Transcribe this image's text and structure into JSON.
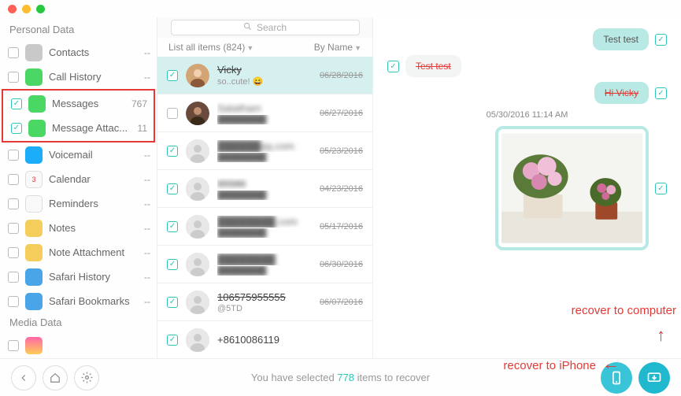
{
  "search_placeholder": "Search",
  "sidebar": {
    "section1": "Personal Data",
    "section2": "Media Data",
    "items": [
      {
        "label": "Contacts",
        "count": "--",
        "checked": false,
        "icon": "contacts",
        "color": "#c9c9c9"
      },
      {
        "label": "Call History",
        "count": "--",
        "checked": false,
        "icon": "phone",
        "color": "#4bd763"
      },
      {
        "label": "Messages",
        "count": "767",
        "checked": true,
        "icon": "msg",
        "color": "#4bd763"
      },
      {
        "label": "Message Attac...",
        "count": "11",
        "checked": true,
        "icon": "attach",
        "color": "#4bd763"
      },
      {
        "label": "Voicemail",
        "count": "--",
        "checked": false,
        "icon": "voicemail",
        "color": "#1badf8"
      },
      {
        "label": "Calendar",
        "count": "--",
        "checked": false,
        "icon": "calendar",
        "color": "#f9f9f9"
      },
      {
        "label": "Reminders",
        "count": "--",
        "checked": false,
        "icon": "reminders",
        "color": "#f9f9f9"
      },
      {
        "label": "Notes",
        "count": "--",
        "checked": false,
        "icon": "notes",
        "color": "#f4cd5a"
      },
      {
        "label": "Note Attachment",
        "count": "--",
        "checked": false,
        "icon": "noteattach",
        "color": "#f4cd5a"
      },
      {
        "label": "Safari History",
        "count": "--",
        "checked": false,
        "icon": "safari",
        "color": "#4aa5e8"
      },
      {
        "label": "Safari Bookmarks",
        "count": "--",
        "checked": false,
        "icon": "bookmark",
        "color": "#4aa5e8"
      }
    ]
  },
  "filter": {
    "left": "List all items (824)",
    "right": "By Name"
  },
  "messages": [
    {
      "name": "Vicky",
      "strike": true,
      "sub": "so..cute! 😄",
      "date": "06/28/2016",
      "checked": true,
      "sel": true,
      "avatar": "photo1"
    },
    {
      "name": "Satatham",
      "strike": false,
      "sub": "████████",
      "date": "06/27/2016",
      "checked": false,
      "avatar": "photo2",
      "blur": true
    },
    {
      "name": "██████qq.com",
      "strike": false,
      "sub": "████████",
      "date": "05/23/2016",
      "checked": true,
      "avatar": "blank",
      "blur": true
    },
    {
      "name": "95580",
      "strike": true,
      "sub": "████████",
      "date": "04/23/2016",
      "checked": true,
      "avatar": "blank",
      "blur": true
    },
    {
      "name": "████████.com",
      "strike": false,
      "sub": "████████",
      "date": "05/17/2016",
      "checked": true,
      "avatar": "blank",
      "blur": true
    },
    {
      "name": "████████",
      "strike": false,
      "sub": "████████",
      "date": "06/30/2016",
      "checked": true,
      "avatar": "blank",
      "blur": true
    },
    {
      "name": "106575955555",
      "strike": true,
      "sub": "@5TD",
      "date": "06/07/2016",
      "checked": true,
      "avatar": "blank"
    },
    {
      "name": "+8610086119",
      "strike": false,
      "sub": "",
      "date": "",
      "checked": true,
      "avatar": "blank"
    }
  ],
  "chat": {
    "b1": "Test test",
    "b2": "Test test",
    "b3": "Hi Vicky",
    "stamp": "05/30/2016 11:14 AM"
  },
  "bottom": {
    "status_pre": "You have selected ",
    "status_num": "778",
    "status_post": " items to recover"
  },
  "annotations": {
    "a1": "recover to iPhone",
    "a2": "recover to computer"
  }
}
